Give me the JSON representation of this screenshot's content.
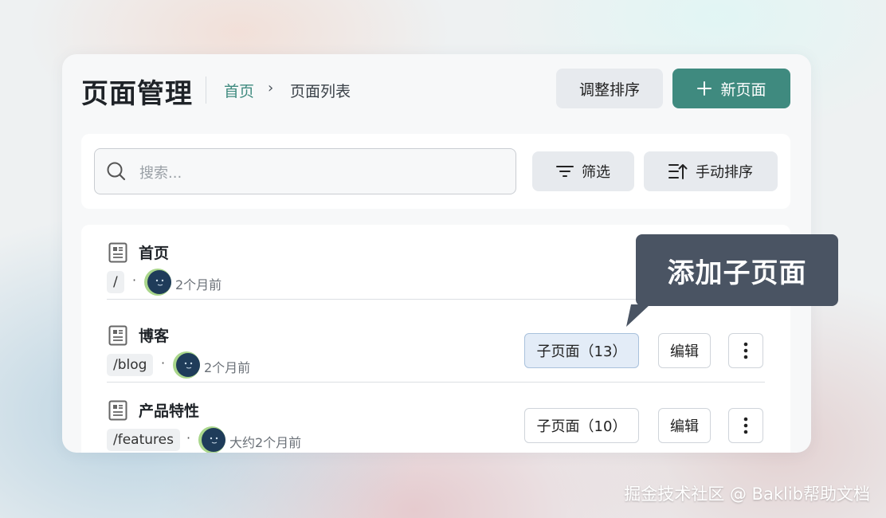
{
  "header": {
    "title": "页面管理",
    "breadcrumb": {
      "home": "首页",
      "separator": "›",
      "current": "页面列表"
    },
    "adjust_order_label": "调整排序",
    "new_page_label": "新页面"
  },
  "toolbar": {
    "search_placeholder": "搜索...",
    "filter_label": "筛选",
    "manual_sort_label": "手动排序"
  },
  "pages": [
    {
      "name": "首页",
      "path": "/",
      "updated": "2个月前"
    },
    {
      "name": "博客",
      "path": "/blog",
      "updated": "2个月前",
      "children_label": "子页面（13）",
      "edit_label": "编辑"
    },
    {
      "name": "产品特性",
      "path": "/features",
      "updated": "大约2个月前",
      "children_label": "子页面（10）",
      "edit_label": "编辑"
    }
  ],
  "tooltip": {
    "text": "添加子页面"
  },
  "watermark": "掘金技术社区 @ Baklib帮助文档",
  "colors": {
    "accent": "#3f8a7f",
    "tooltip_bg": "#4a5463",
    "highlight_bg": "#e3ecf7"
  },
  "icons": [
    "search-icon",
    "filter-icon",
    "sort-icon",
    "plus-icon",
    "document-icon",
    "more-vertical-icon"
  ]
}
